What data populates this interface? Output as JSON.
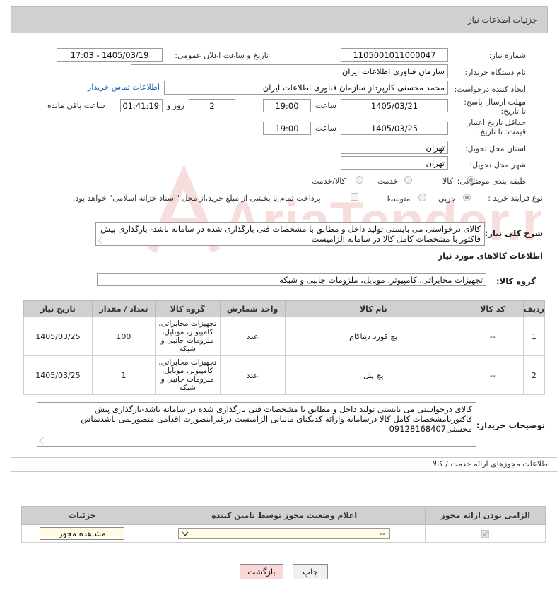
{
  "header": {
    "title": "جزئیات اطلاعات نیاز"
  },
  "fields": {
    "need_number_label": "شماره نیاز:",
    "need_number": "1105001011000047",
    "announce_label": "تاریخ و ساعت اعلان عمومی:",
    "announce_value": "1405/03/19 - 17:03",
    "buyer_org_label": "نام دستگاه خریدار:",
    "buyer_org": "سازمان فناوری اطلاعات ایران",
    "requester_label": "ایجاد کننده درخواست:",
    "requester": "محمد محسنی کارپرداز سازمان فناوری اطلاعات ایران",
    "contact_link": "اطلاعات تماس خریدار",
    "reply_deadline_label": "مهلت ارسال پاسخ: تا تاریخ:",
    "reply_date": "1405/03/21",
    "time_label": "ساعت",
    "reply_time": "19:00",
    "days_value": "2",
    "days_label": "روز و",
    "remaining_time": "01:41:19",
    "remaining_label": "ساعت باقی مانده",
    "price_validity_label": "حداقل تاریخ اعتبار قیمت: تا تاریخ:",
    "price_date": "1405/03/25",
    "price_time": "19:00",
    "province_label": "استان محل تحویل:",
    "province": "تهران",
    "city_label": "شهر محل تحویل:",
    "city": "تهران",
    "category_label": "طبقه بندی موضوعی:",
    "category_options": [
      "کالا",
      "خدمت",
      "کالا/خدمت"
    ],
    "process_label": "نوع فرآیند خرید :",
    "process_options": [
      "جزیی",
      "متوسط"
    ],
    "treasury_note": "پرداخت تمام یا بخشی از مبلغ خرید،از محل \"اسناد خزانه اسلامی\" خواهد بود."
  },
  "description": {
    "label": "شرح کلی نیاز:",
    "text": "کالای درخواستی می بایستی تولید داخل و مطابق با مشخصات فنی بارگذاری شده در سامانه باشد- بارگذاری پیش فاکتور با مشخصات کامل کالا در سامانه الزامیست"
  },
  "goods_section": {
    "title": "اطلاعات کالاهای مورد نیاز",
    "group_label": "گروه کالا:",
    "group_value": "تجهیزات مخابراتی، کامپیوتر، موبایل، ملزومات جانبی و شبکه"
  },
  "items_table": {
    "headers": [
      "ردیف",
      "کد کالا",
      "نام کالا",
      "واحد شمارش",
      "گروه کالا",
      "تعداد / مقدار",
      "تاریخ نیاز"
    ],
    "rows": [
      {
        "idx": "1",
        "code": "--",
        "name": "پچ کورد دیتاکام",
        "unit": "عدد",
        "group": "تجهیزات مخابراتی، کامپیوتر، موبایل، ملزومات جانبی و شبکه",
        "qty": "100",
        "date": "1405/03/25"
      },
      {
        "idx": "2",
        "code": "--",
        "name": "پچ پنل",
        "unit": "عدد",
        "group": "تجهیزات مخابراتی، کامپیوتر، موبایل، ملزومات جانبی و شبکه",
        "qty": "1",
        "date": "1405/03/25"
      }
    ]
  },
  "buyer_notes": {
    "label": "توضیحات خریدار:",
    "text": "کالای درخواستی می بایستی تولید داخل و مطابق با مشخصات فنی بارگذاری شده در سامانه باشد-بارگذاری پیش فاکتوربامشخصات کامل کالا درسامانه وارائه کدیکتای مالیاتی الزامیست درغیراینصورت اقدامی متصورنمی باشدتماس محسنی09128168407"
  },
  "license_section": {
    "title": "اطلاعات مجوزهای ارائه خدمت / کالا",
    "headers": [
      "الزامی بودن ارائه مجوز",
      "اعلام وضعیت مجوز توسط تامین کننده",
      "جزئیات"
    ],
    "select_value": "--",
    "view_button": "مشاهده مجوز"
  },
  "buttons": {
    "print": "چاپ",
    "back": "بازگشت"
  },
  "watermark": {
    "text": "AriaTender.neT"
  },
  "colors": {
    "header_bg": "#d0d0d0",
    "link": "#1a5fb4",
    "back_btn": "#f8d7d7",
    "select_bg": "#fffbe6"
  }
}
